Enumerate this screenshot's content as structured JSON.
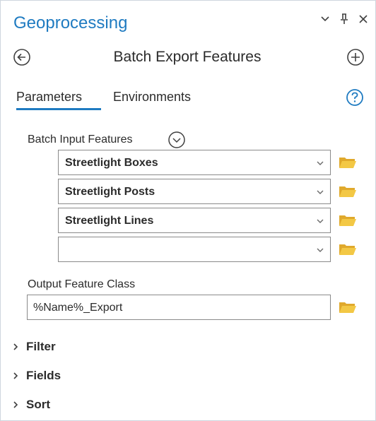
{
  "pane": {
    "title": "Geoprocessing"
  },
  "tool": {
    "name": "Batch Export Features"
  },
  "tabs": [
    {
      "label": "Parameters",
      "active": true
    },
    {
      "label": "Environments",
      "active": false
    }
  ],
  "parameters": {
    "batch_input_label": "Batch Input Features",
    "batch_inputs": [
      {
        "value": "Streetlight Boxes"
      },
      {
        "value": "Streetlight Posts"
      },
      {
        "value": "Streetlight Lines"
      },
      {
        "value": ""
      }
    ],
    "output_label": "Output Feature Class",
    "output_value": "%Name%_Export"
  },
  "sections": [
    {
      "label": "Filter"
    },
    {
      "label": "Fields"
    },
    {
      "label": "Sort"
    }
  ],
  "icons": {
    "title_controls": [
      "chevron-down-icon",
      "pin-icon",
      "close-icon"
    ],
    "back": "back-arrow-icon",
    "add": "add-icon",
    "help": "help-icon",
    "expand": "expand-icon",
    "folder": "folder-icon"
  },
  "colors": {
    "accent": "#1f7bc1",
    "folder": "#f0c23b",
    "border": "#8a8a8a",
    "text": "#2b2b2b"
  }
}
